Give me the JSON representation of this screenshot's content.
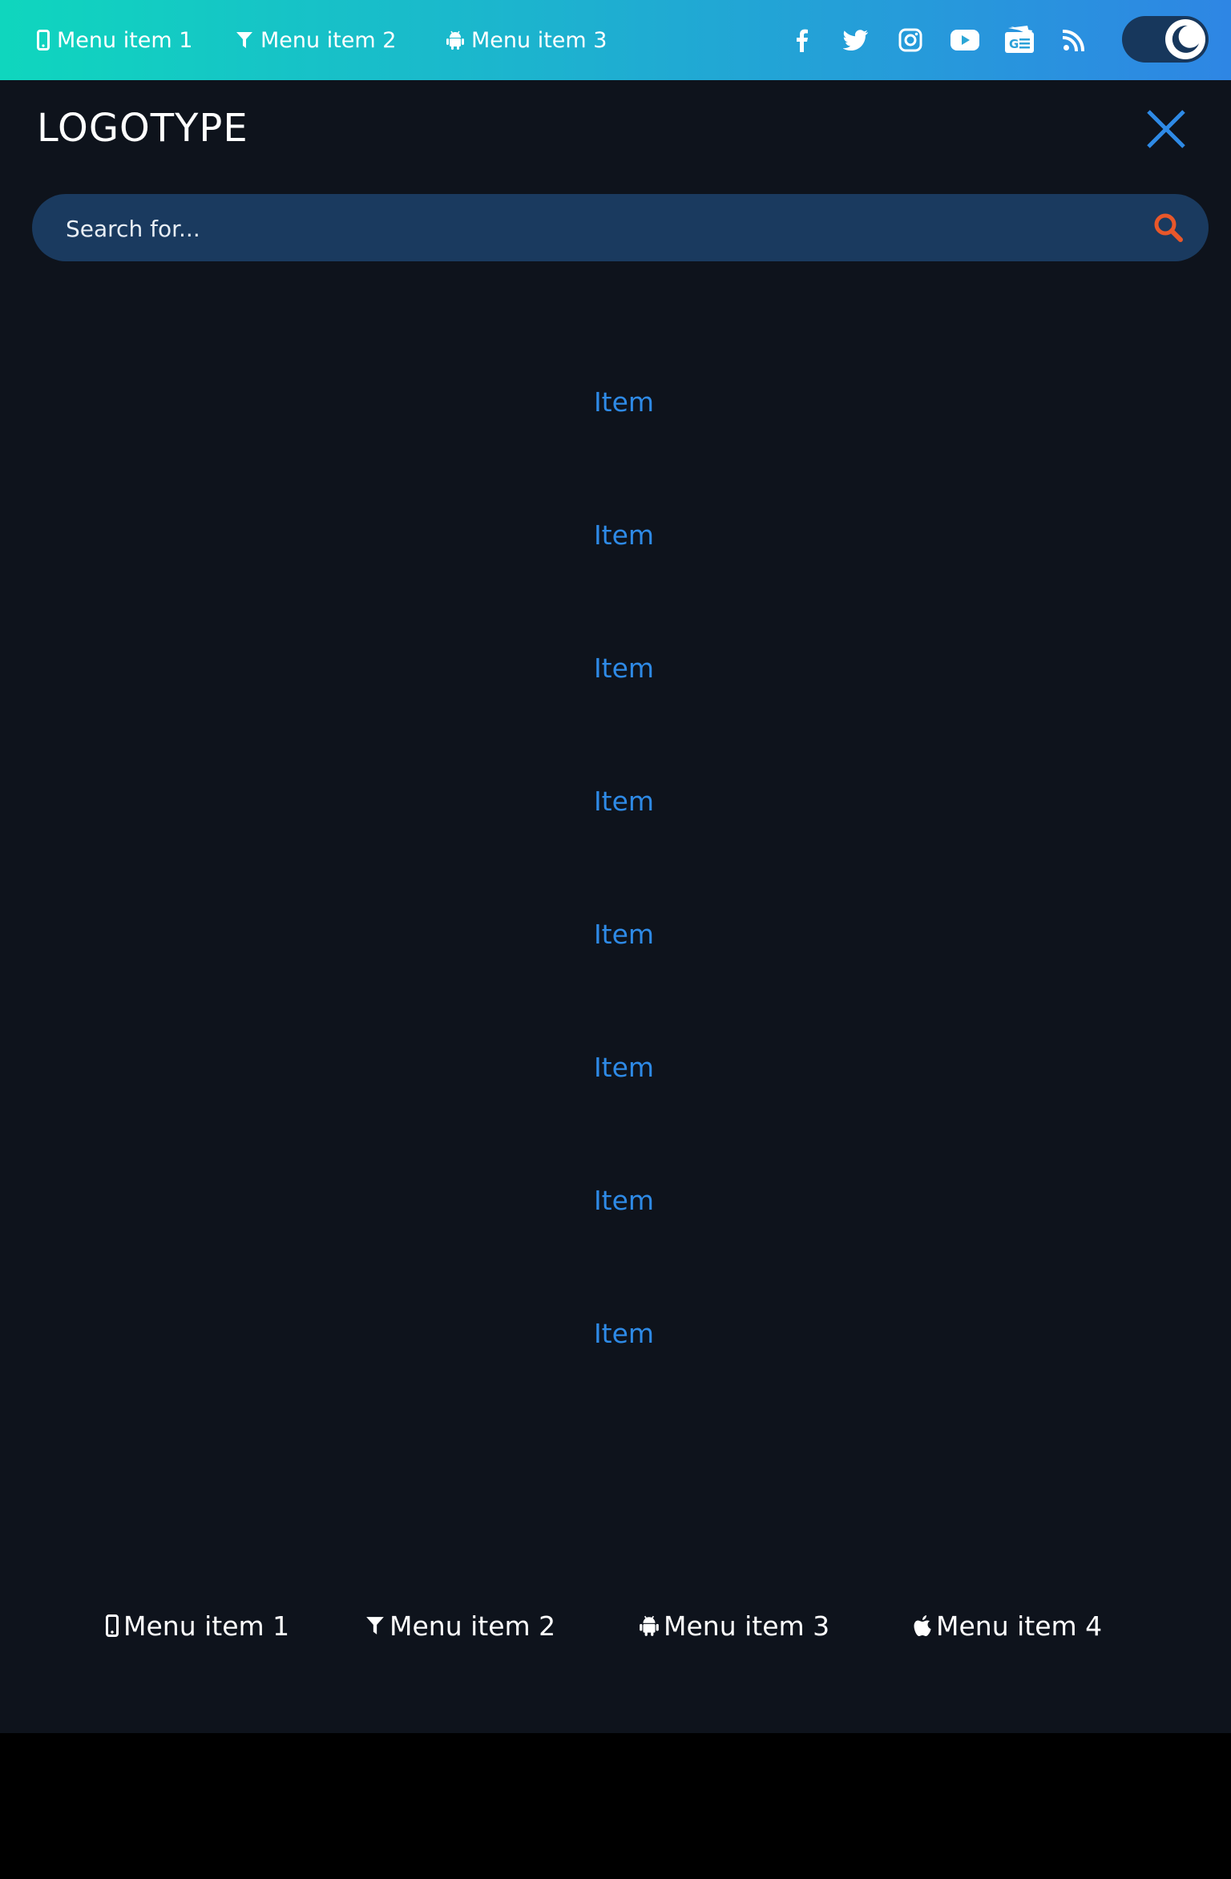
{
  "top_menu": [
    {
      "label": "Menu item 1",
      "icon": "mobile-icon"
    },
    {
      "label": "Menu item 2",
      "icon": "filter-icon"
    },
    {
      "label": "Menu item 3",
      "icon": "android-icon"
    }
  ],
  "social_icons": [
    "facebook-icon",
    "twitter-icon",
    "instagram-icon",
    "youtube-icon",
    "google-news-icon",
    "rss-icon"
  ],
  "theme_toggle": {
    "icon": "moon-icon"
  },
  "header": {
    "logo": "LOGOTYPE",
    "close_icon": "close-icon"
  },
  "search": {
    "placeholder": "Search for...",
    "icon": "search-icon"
  },
  "nav_items": [
    "Item",
    "Item",
    "Item",
    "Item",
    "Item",
    "Item",
    "Item",
    "Item"
  ],
  "bottom_menu": [
    {
      "label": "Menu item 1",
      "icon": "mobile-icon"
    },
    {
      "label": "Menu item 2",
      "icon": "filter-icon"
    },
    {
      "label": "Menu item 3",
      "icon": "android-icon"
    },
    {
      "label": "Menu item 4",
      "icon": "apple-icon"
    }
  ],
  "colors": {
    "gradient_start": "#0fd6be",
    "gradient_end": "#2e86e4",
    "background": "#0e131c",
    "accent": "#2e8ae6",
    "search_bg": "#1a3a5f",
    "search_icon": "#e8572a"
  }
}
